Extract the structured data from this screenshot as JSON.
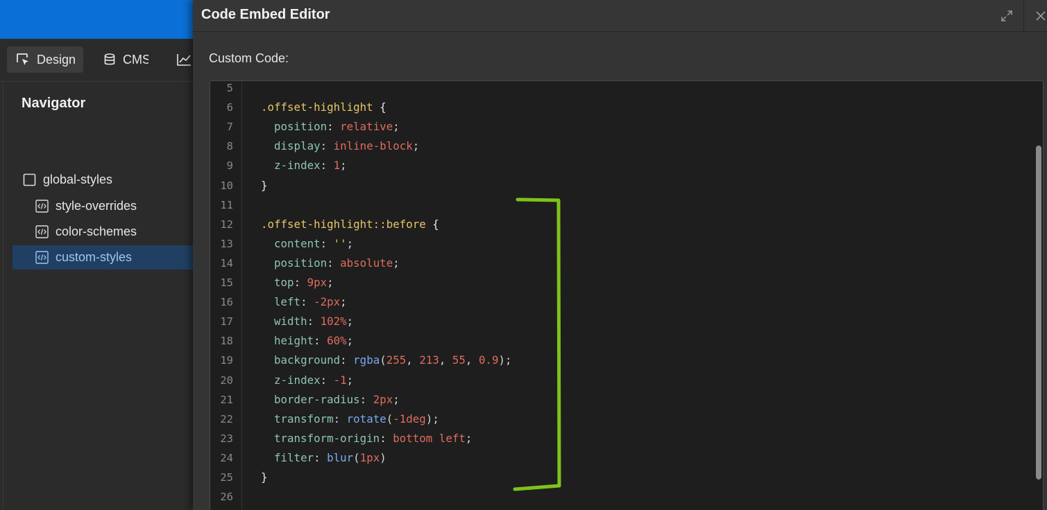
{
  "sidebar": {
    "tabs": [
      {
        "label": "Design",
        "icon": "cursor-select-icon"
      },
      {
        "label": "CMS",
        "icon": "database-icon"
      },
      {
        "label": "",
        "icon": "chart-line-icon"
      }
    ],
    "navigator_title": "Navigator",
    "items": [
      {
        "label": "global-styles",
        "icon": "square-icon"
      },
      {
        "label": "style-overrides",
        "icon": "code-embed-icon"
      },
      {
        "label": "color-schemes",
        "icon": "code-embed-icon"
      },
      {
        "label": "custom-styles",
        "icon": "code-embed-icon",
        "selected": true
      }
    ]
  },
  "modal": {
    "title": "Code Embed Editor",
    "code_label": "Custom Code:",
    "expand_icon": "expand-icon",
    "close_icon": "close-icon"
  },
  "colors": {
    "top_bar": "#0a6fd6",
    "selected_item_bg": "#203f63",
    "annotation_bracket": "#7dc31a"
  },
  "editor": {
    "lines": [
      {
        "n": "5",
        "tokens": []
      },
      {
        "n": "6",
        "tokens": [
          {
            "t": ".offset-highlight",
            "c": "sel"
          },
          {
            "t": " {",
            "c": "brace"
          }
        ]
      },
      {
        "n": "7",
        "tokens": [
          {
            "t": "  position",
            "c": "prop"
          },
          {
            "t": ": ",
            "c": "punc"
          },
          {
            "t": "relative",
            "c": "val"
          },
          {
            "t": ";",
            "c": "punc"
          }
        ]
      },
      {
        "n": "8",
        "tokens": [
          {
            "t": "  display",
            "c": "prop"
          },
          {
            "t": ": ",
            "c": "punc"
          },
          {
            "t": "inline-block",
            "c": "val"
          },
          {
            "t": ";",
            "c": "punc"
          }
        ]
      },
      {
        "n": "9",
        "tokens": [
          {
            "t": "  z-index",
            "c": "prop"
          },
          {
            "t": ": ",
            "c": "punc"
          },
          {
            "t": "1",
            "c": "val"
          },
          {
            "t": ";",
            "c": "punc"
          }
        ]
      },
      {
        "n": "10",
        "tokens": [
          {
            "t": "}",
            "c": "brace"
          }
        ]
      },
      {
        "n": "11",
        "tokens": []
      },
      {
        "n": "12",
        "tokens": [
          {
            "t": ".offset-highlight::before",
            "c": "sel"
          },
          {
            "t": " {",
            "c": "brace"
          }
        ]
      },
      {
        "n": "13",
        "tokens": [
          {
            "t": "  content",
            "c": "prop"
          },
          {
            "t": ": ",
            "c": "punc"
          },
          {
            "t": "''",
            "c": "str"
          },
          {
            "t": ";",
            "c": "punc"
          }
        ]
      },
      {
        "n": "14",
        "tokens": [
          {
            "t": "  position",
            "c": "prop"
          },
          {
            "t": ": ",
            "c": "punc"
          },
          {
            "t": "absolute",
            "c": "val"
          },
          {
            "t": ";",
            "c": "punc"
          }
        ]
      },
      {
        "n": "15",
        "tokens": [
          {
            "t": "  top",
            "c": "prop"
          },
          {
            "t": ": ",
            "c": "punc"
          },
          {
            "t": "9px",
            "c": "val"
          },
          {
            "t": ";",
            "c": "punc"
          }
        ]
      },
      {
        "n": "16",
        "tokens": [
          {
            "t": "  left",
            "c": "prop"
          },
          {
            "t": ": ",
            "c": "punc"
          },
          {
            "t": "-2px",
            "c": "val"
          },
          {
            "t": ";",
            "c": "punc"
          }
        ]
      },
      {
        "n": "17",
        "tokens": [
          {
            "t": "  width",
            "c": "prop"
          },
          {
            "t": ": ",
            "c": "punc"
          },
          {
            "t": "102%",
            "c": "val"
          },
          {
            "t": ";",
            "c": "punc"
          }
        ]
      },
      {
        "n": "18",
        "tokens": [
          {
            "t": "  height",
            "c": "prop"
          },
          {
            "t": ": ",
            "c": "punc"
          },
          {
            "t": "60%",
            "c": "val"
          },
          {
            "t": ";",
            "c": "punc"
          }
        ]
      },
      {
        "n": "19",
        "tokens": [
          {
            "t": "  background",
            "c": "prop"
          },
          {
            "t": ": ",
            "c": "punc"
          },
          {
            "t": "rgba",
            "c": "fn"
          },
          {
            "t": "(",
            "c": "punc"
          },
          {
            "t": "255",
            "c": "val"
          },
          {
            "t": ", ",
            "c": "punc"
          },
          {
            "t": "213",
            "c": "val"
          },
          {
            "t": ", ",
            "c": "punc"
          },
          {
            "t": "55",
            "c": "val"
          },
          {
            "t": ", ",
            "c": "punc"
          },
          {
            "t": "0.9",
            "c": "val"
          },
          {
            "t": ");",
            "c": "punc"
          }
        ]
      },
      {
        "n": "20",
        "tokens": [
          {
            "t": "  z-index",
            "c": "prop"
          },
          {
            "t": ": ",
            "c": "punc"
          },
          {
            "t": "-1",
            "c": "val"
          },
          {
            "t": ";",
            "c": "punc"
          }
        ]
      },
      {
        "n": "21",
        "tokens": [
          {
            "t": "  border-radius",
            "c": "prop"
          },
          {
            "t": ": ",
            "c": "punc"
          },
          {
            "t": "2px",
            "c": "val"
          },
          {
            "t": ";",
            "c": "punc"
          }
        ]
      },
      {
        "n": "22",
        "tokens": [
          {
            "t": "  transform",
            "c": "prop"
          },
          {
            "t": ": ",
            "c": "punc"
          },
          {
            "t": "rotate",
            "c": "fn"
          },
          {
            "t": "(",
            "c": "punc"
          },
          {
            "t": "-1deg",
            "c": "val"
          },
          {
            "t": ");",
            "c": "punc"
          }
        ]
      },
      {
        "n": "23",
        "tokens": [
          {
            "t": "  transform-origin",
            "c": "prop"
          },
          {
            "t": ": ",
            "c": "punc"
          },
          {
            "t": "bottom left",
            "c": "val"
          },
          {
            "t": ";",
            "c": "punc"
          }
        ]
      },
      {
        "n": "24",
        "tokens": [
          {
            "t": "  filter",
            "c": "prop"
          },
          {
            "t": ": ",
            "c": "punc"
          },
          {
            "t": "blur",
            "c": "fn"
          },
          {
            "t": "(",
            "c": "punc"
          },
          {
            "t": "1px",
            "c": "val"
          },
          {
            "t": ")",
            "c": "punc"
          }
        ]
      },
      {
        "n": "25",
        "tokens": [
          {
            "t": "}",
            "c": "brace"
          }
        ]
      },
      {
        "n": "26",
        "tokens": []
      }
    ]
  }
}
